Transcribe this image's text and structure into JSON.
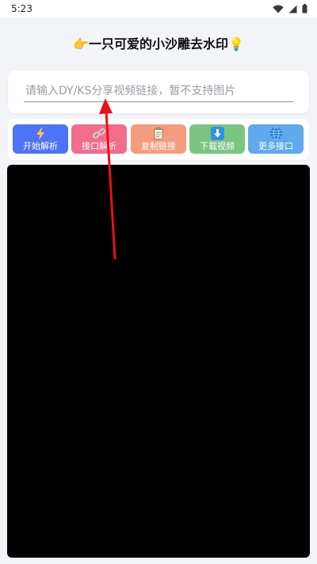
{
  "status_bar": {
    "time": "5:23"
  },
  "header": {
    "title": "👉一只可爱的小沙雕去水印💡"
  },
  "search": {
    "value": "",
    "placeholder": "请输入DY/KS分享视频链接，暂不支持图片"
  },
  "actions": [
    {
      "label": "开始解析",
      "icon": "lightning-icon",
      "color": "#4e73f5"
    },
    {
      "label": "接口解析",
      "icon": "link-icon",
      "color": "#f26c8c"
    },
    {
      "label": "复制链接",
      "icon": "clipboard-icon",
      "color": "#f39d7d"
    },
    {
      "label": "下载视频",
      "icon": "download-icon",
      "color": "#7bc580"
    },
    {
      "label": "更多接口",
      "icon": "globe-icon",
      "color": "#5fa9ec"
    }
  ],
  "colors": {
    "background": "#f3f4f8",
    "video_area": "#000000",
    "annotation_arrow": "#e8101a"
  }
}
